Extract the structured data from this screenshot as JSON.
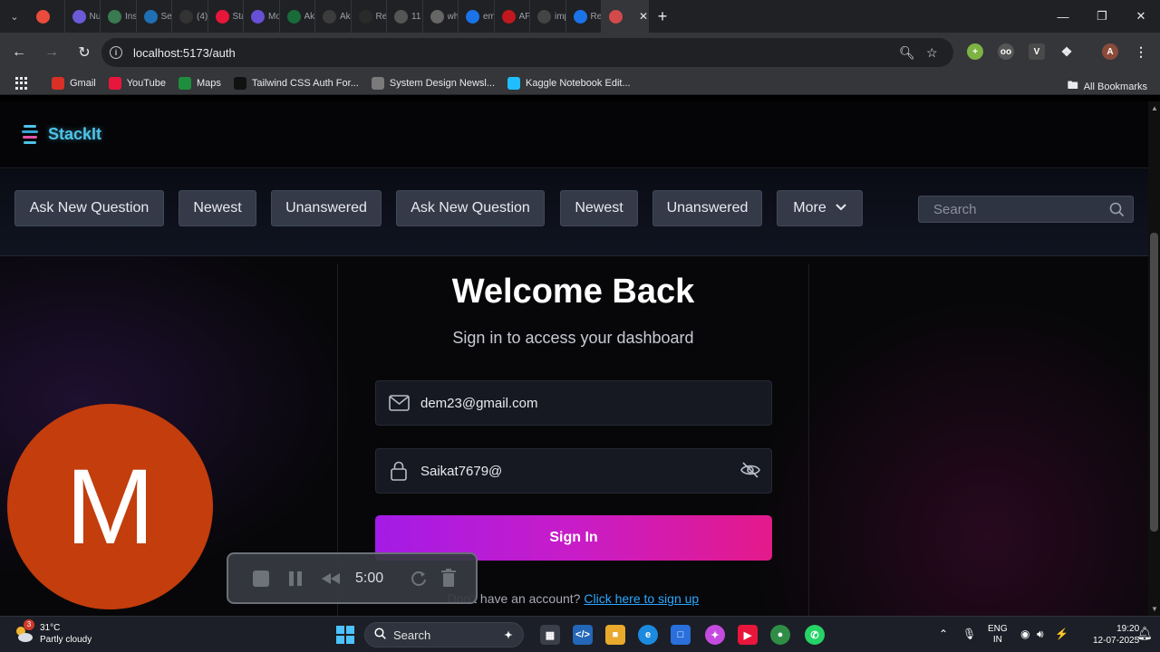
{
  "browser": {
    "tabs": [
      {
        "title": "",
        "icon": "record-icon",
        "color": "#e94b3c"
      },
      {
        "title": "Nur",
        "icon": "gear-tab-icon",
        "color": "#6b5bd8"
      },
      {
        "title": "Inst",
        "icon": "github-copilot-icon",
        "color": "#3a7a50"
      },
      {
        "title": "Set",
        "icon": "swirl-icon",
        "color": "#1f6fb5"
      },
      {
        "title": "(4)",
        "icon": "dev-icon",
        "color": "#333333"
      },
      {
        "title": "Sta",
        "icon": "youtube-icon",
        "color": "#e8163b"
      },
      {
        "title": "Mo",
        "icon": "x-icon",
        "color": "#6750d6"
      },
      {
        "title": "Aka",
        "icon": "mongodb-icon",
        "color": "#1a6b3a"
      },
      {
        "title": "Aka",
        "icon": "github-icon",
        "color": "#3c3c3c"
      },
      {
        "title": "Re",
        "icon": "circle-icon",
        "color": "#2a2a2a"
      },
      {
        "title": "11",
        "icon": "list-icon",
        "color": "#555555"
      },
      {
        "title": "wh",
        "icon": "globe-icon",
        "color": "#666666"
      },
      {
        "title": "em",
        "icon": "google-icon",
        "color": "#1a73e8"
      },
      {
        "title": "AP",
        "icon": "news-icon",
        "color": "#c0181e"
      },
      {
        "title": "imp",
        "icon": "openai-icon",
        "color": "#444444"
      },
      {
        "title": "Rea",
        "icon": "google-icon",
        "color": "#1a73e8"
      },
      {
        "title": "",
        "icon": "react-icon",
        "color": "#d24a4a"
      }
    ],
    "url": "localhost:5173/auth",
    "bookmarks": [
      {
        "label": "Gmail",
        "icon": "gmail-icon",
        "color": "#d93025"
      },
      {
        "label": "YouTube",
        "icon": "youtube-icon",
        "color": "#e8163b"
      },
      {
        "label": "Maps",
        "icon": "maps-icon",
        "color": "#1e8e3e"
      },
      {
        "label": "Tailwind CSS Auth For...",
        "icon": "ui-icon",
        "color": "#111111"
      },
      {
        "label": "System Design Newsl...",
        "icon": "newsletter-icon",
        "color": "#7a7a7a"
      },
      {
        "label": "Kaggle Notebook Edit...",
        "icon": "kaggle-icon",
        "color": "#20beff"
      }
    ],
    "all_bookmarks": "All Bookmarks",
    "profile_initial": "A"
  },
  "app": {
    "logo": "StackIt",
    "actions": [
      "Ask New Question",
      "Newest",
      "Unanswered",
      "Ask New Question",
      "Newest",
      "Unanswered"
    ],
    "more": "More",
    "search_placeholder": "Search"
  },
  "auth": {
    "title": "Welcome Back",
    "subtitle": "Sign in to access your dashboard",
    "email": "dem23@gmail.com",
    "password": "Saikat7679@",
    "signin": "Sign In",
    "signup_prompt": "Don't have an account?",
    "signup_link": "Click here to sign up"
  },
  "overlay": {
    "avatar_letter": "M",
    "recorder_time": "5:00"
  },
  "taskbar": {
    "temperature": "31°C",
    "weather": "Partly cloudy",
    "weather_badge": "3",
    "search": "Search",
    "lang1": "ENG",
    "lang2": "IN",
    "time": "19:20",
    "date": "12-07-2025"
  },
  "colors": {
    "brand": "#4fc3e8",
    "signin_from": "#a41be6",
    "signin_to": "#e41a8a",
    "link": "#2aa7ff",
    "avatar": "#c33d0d"
  }
}
